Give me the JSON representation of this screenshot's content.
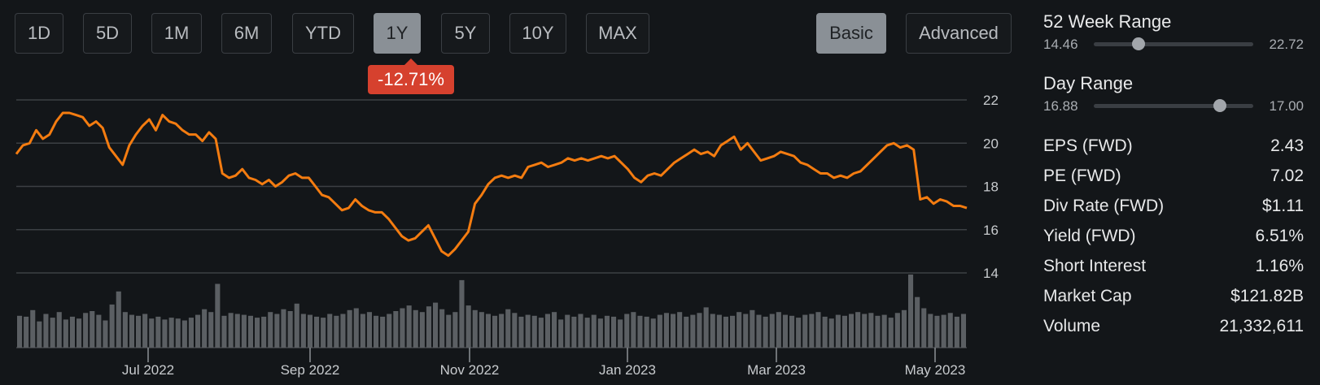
{
  "range_buttons": [
    {
      "label": "1D",
      "active": false
    },
    {
      "label": "5D",
      "active": false
    },
    {
      "label": "1M",
      "active": false
    },
    {
      "label": "6M",
      "active": false
    },
    {
      "label": "YTD",
      "active": false
    },
    {
      "label": "1Y",
      "active": true
    },
    {
      "label": "5Y",
      "active": false
    },
    {
      "label": "10Y",
      "active": false
    },
    {
      "label": "MAX",
      "active": false
    }
  ],
  "change_badge": "-12.71%",
  "view_toggle": {
    "basic": "Basic",
    "advanced": "Advanced",
    "active": "Basic"
  },
  "colors": {
    "line": "#f47c10",
    "volume": "#5b5f63",
    "grid": "#3c4044",
    "change_negative": "#d6412e"
  },
  "chart_data": {
    "type": "line",
    "x_tick_labels": [
      "Jul 2022",
      "Sep 2022",
      "Nov 2022",
      "Jan 2023",
      "Mar 2023",
      "May 2023"
    ],
    "y_tick_labels": [
      "14",
      "16",
      "18",
      "20",
      "22"
    ],
    "ylim": [
      14,
      22
    ],
    "grid": true,
    "series": [
      {
        "values": [
          19.5,
          19.9,
          20.0,
          20.6,
          20.2,
          20.4,
          21.0,
          21.4,
          21.4,
          21.3,
          21.2,
          20.8,
          21.0,
          20.7,
          19.8,
          19.4,
          19.0,
          19.9,
          20.4,
          20.8,
          21.1,
          20.6,
          21.3,
          21.0,
          20.9,
          20.6,
          20.4,
          20.4,
          20.1,
          20.5,
          20.2,
          18.6,
          18.4,
          18.5,
          18.8,
          18.4,
          18.3,
          18.1,
          18.3,
          18.0,
          18.2,
          18.5,
          18.6,
          18.4,
          18.4,
          18.0,
          17.6,
          17.5,
          17.2,
          16.9,
          17.0,
          17.4,
          17.1,
          16.9,
          16.8,
          16.8,
          16.5,
          16.1,
          15.7,
          15.5,
          15.6,
          15.9,
          16.2,
          15.6,
          15.0,
          14.8,
          15.1,
          15.5,
          15.9,
          17.2,
          17.6,
          18.1,
          18.4,
          18.5,
          18.4,
          18.5,
          18.4,
          18.9,
          19.0,
          19.1,
          18.9,
          19.0,
          19.1,
          19.3,
          19.2,
          19.3,
          19.2,
          19.3,
          19.4,
          19.3,
          19.4,
          19.1,
          18.8,
          18.4,
          18.2,
          18.5,
          18.6,
          18.5,
          18.8,
          19.1,
          19.3,
          19.5,
          19.7,
          19.5,
          19.6,
          19.4,
          19.9,
          20.1,
          20.3,
          19.7,
          20.0,
          19.6,
          19.2,
          19.3,
          19.4,
          19.6,
          19.5,
          19.4,
          19.1,
          19.0,
          18.8,
          18.6,
          18.6,
          18.4,
          18.5,
          18.4,
          18.6,
          18.7,
          19.0,
          19.3,
          19.6,
          19.9,
          20.0,
          19.8,
          19.9,
          19.7,
          17.4,
          17.5,
          17.2,
          17.4,
          17.3,
          17.1,
          17.1,
          17.0
        ]
      }
    ],
    "volume_values": [
      34,
      33,
      40,
      28,
      36,
      32,
      38,
      30,
      33,
      31,
      37,
      39,
      35,
      29,
      46,
      60,
      38,
      35,
      34,
      36,
      31,
      33,
      30,
      32,
      31,
      29,
      32,
      35,
      41,
      38,
      68,
      34,
      37,
      36,
      35,
      34,
      32,
      33,
      38,
      36,
      41,
      39,
      47,
      36,
      35,
      33,
      32,
      36,
      34,
      36,
      40,
      42,
      36,
      38,
      34,
      33,
      36,
      39,
      42,
      45,
      40,
      38,
      44,
      48,
      41,
      35,
      38,
      72,
      45,
      40,
      38,
      36,
      34,
      36,
      41,
      37,
      33,
      35,
      34,
      32,
      36,
      38,
      30,
      35,
      33,
      36,
      32,
      35,
      31,
      34,
      33,
      30,
      36,
      38,
      34,
      33,
      31,
      35,
      37,
      36,
      38,
      33,
      35,
      37,
      43,
      36,
      35,
      33,
      34,
      38,
      36,
      40,
      35,
      33,
      36,
      38,
      35,
      34,
      32,
      35,
      36,
      38,
      33,
      31,
      35,
      34,
      36,
      38,
      36,
      37,
      34,
      35,
      32,
      37,
      40,
      78,
      54,
      42,
      36,
      34,
      35,
      37,
      33,
      36
    ]
  },
  "week52_range": {
    "title": "52 Week Range",
    "low": "14.46",
    "high": "22.72",
    "position": 0.28
  },
  "day_range": {
    "title": "Day Range",
    "low": "16.88",
    "high": "17.00",
    "position": 0.79
  },
  "stats": [
    {
      "label": "EPS (FWD)",
      "value": "2.43"
    },
    {
      "label": "PE (FWD)",
      "value": "7.02"
    },
    {
      "label": "Div Rate (FWD)",
      "value": "$1.11"
    },
    {
      "label": "Yield (FWD)",
      "value": "6.51%"
    },
    {
      "label": "Short Interest",
      "value": "1.16%"
    },
    {
      "label": "Market Cap",
      "value": "$121.82B"
    },
    {
      "label": "Volume",
      "value": "21,332,611"
    }
  ]
}
